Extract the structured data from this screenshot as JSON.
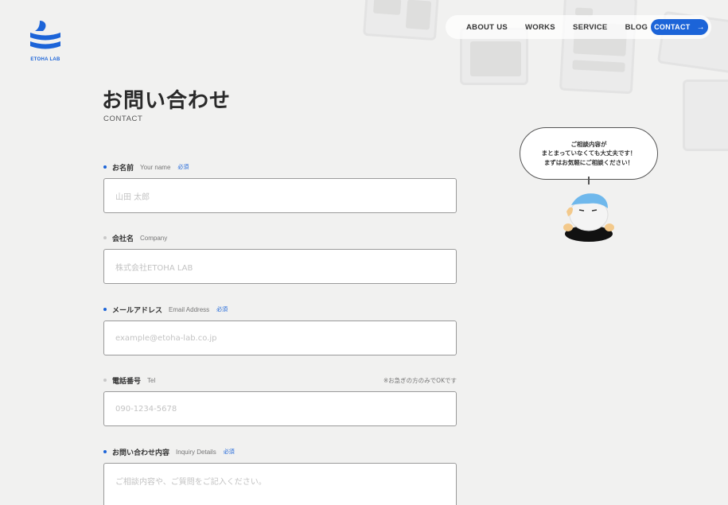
{
  "brand": {
    "logo_text": "ETOHA LAB",
    "accent": "#1c64d8"
  },
  "nav": {
    "links": [
      "ABOUT US",
      "WORKS",
      "SERVICE",
      "BLOG"
    ],
    "cta_label": "CONTACT",
    "cta_icon": "arrow-right-icon"
  },
  "page": {
    "title": "お問い合わせ",
    "subtitle": "CONTACT"
  },
  "form": {
    "fields": [
      {
        "label": "お名前",
        "label_en": "Your name",
        "required": "必須",
        "placeholder": "山田 太郎"
      },
      {
        "label": "会社名",
        "label_en": "Company",
        "placeholder": "株式会社ETOHA LAB"
      },
      {
        "label": "メールアドレス",
        "label_en": "Email Address",
        "required": "必須",
        "placeholder": "example@etoha-lab.co.jp"
      },
      {
        "label": "電話番号",
        "label_en": "Tel",
        "note": "※お急ぎの方のみでOKです",
        "placeholder": "090-1234-5678"
      },
      {
        "label": "お問い合わせ内容",
        "label_en": "Inquiry Details",
        "required": "必須",
        "placeholder": "ご相談内容や、ご質問をご記入ください。"
      }
    ]
  },
  "mascot": {
    "bubble_lines": [
      "ご相談内容が",
      "まとまっていなくても大丈夫です！",
      "まずはお気軽にご相談ください！"
    ]
  }
}
